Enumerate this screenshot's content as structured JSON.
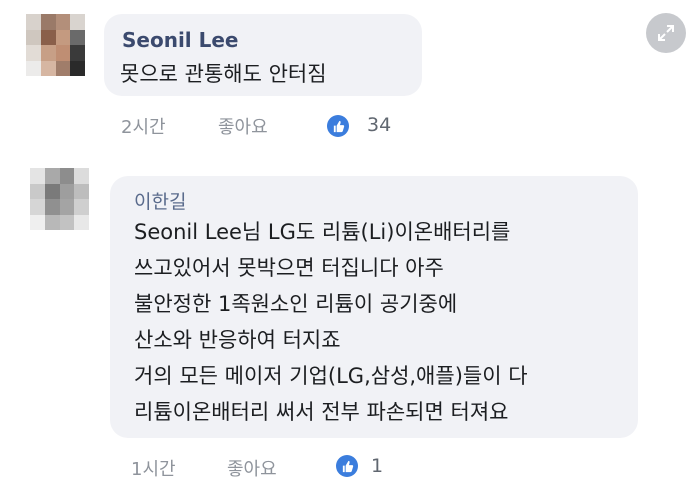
{
  "comments": [
    {
      "author": "Seonil Lee",
      "text": "못으로 관통해도 안터짐",
      "time": "2시간",
      "like_label": "좋아요",
      "like_count": "34"
    },
    {
      "author": "이한길",
      "lines": [
        "Seonil Lee님 LG도 리튬(Li)이온배터리를",
        "쓰고있어서 못박으면 터집니다 아주",
        "불안정한 1족원소인 리튬이 공기중에",
        "산소와 반응하여 터지죠",
        "거의 모든 메이저 기업(LG,삼성,애플)들이 다",
        "리튬이온배터리 써서 전부 파손되면 터져요"
      ],
      "time": "1시간",
      "like_label": "좋아요",
      "like_count": "1"
    }
  ],
  "icons": {
    "like": "thumbs-up-icon",
    "expand": "expand-icon"
  },
  "colors": {
    "bubble": "#f1f2f6",
    "like_badge": "#3b7ddd",
    "meta_text": "#8f949c"
  }
}
